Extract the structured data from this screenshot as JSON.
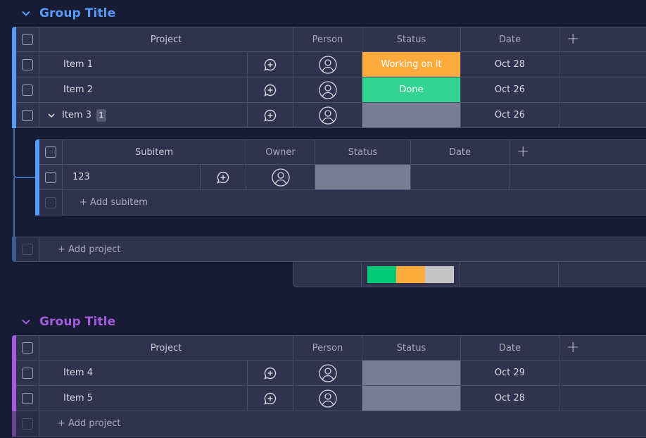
{
  "colors": {
    "group1": "#579bfc",
    "group2": "#a25ddc",
    "working": "#fdab3d",
    "done": "#33d391",
    "empty": "#797e93",
    "summary_green": "#00c875",
    "summary_orange": "#fdab3d",
    "summary_grey": "#c4c4c4"
  },
  "groups": [
    {
      "title": "Group Title",
      "columns": {
        "project": "Project",
        "person": "Person",
        "status": "Status",
        "date": "Date",
        "add": "+"
      },
      "items": [
        {
          "name": "Item 1",
          "status": "Working on it",
          "status_color": "working",
          "date": "Oct 28"
        },
        {
          "name": "Item 2",
          "status": "Done",
          "status_color": "done",
          "date": "Oct 26"
        },
        {
          "name": "Item 3",
          "status": "",
          "status_color": "empty",
          "date": "Oct 26",
          "subitem_count": "1"
        }
      ],
      "subitems": {
        "columns": {
          "subitem": "Subitem",
          "owner": "Owner",
          "status": "Status",
          "date": "Date",
          "add": "+"
        },
        "items": [
          {
            "name": "123",
            "status": "",
            "date": ""
          }
        ],
        "add_label": "+ Add subitem"
      },
      "add_label": "+ Add project",
      "status_summary": [
        {
          "color": "summary_green",
          "fraction": 0.333
        },
        {
          "color": "summary_orange",
          "fraction": 0.333
        },
        {
          "color": "summary_grey",
          "fraction": 0.334
        }
      ]
    },
    {
      "title": "Group Title",
      "columns": {
        "project": "Project",
        "person": "Person",
        "status": "Status",
        "date": "Date",
        "add": "+"
      },
      "items": [
        {
          "name": "Item 4",
          "status": "",
          "status_color": "empty",
          "date": "Oct 29"
        },
        {
          "name": "Item 5",
          "status": "",
          "status_color": "empty",
          "date": "Oct 28"
        }
      ],
      "add_label": "+ Add project"
    }
  ]
}
